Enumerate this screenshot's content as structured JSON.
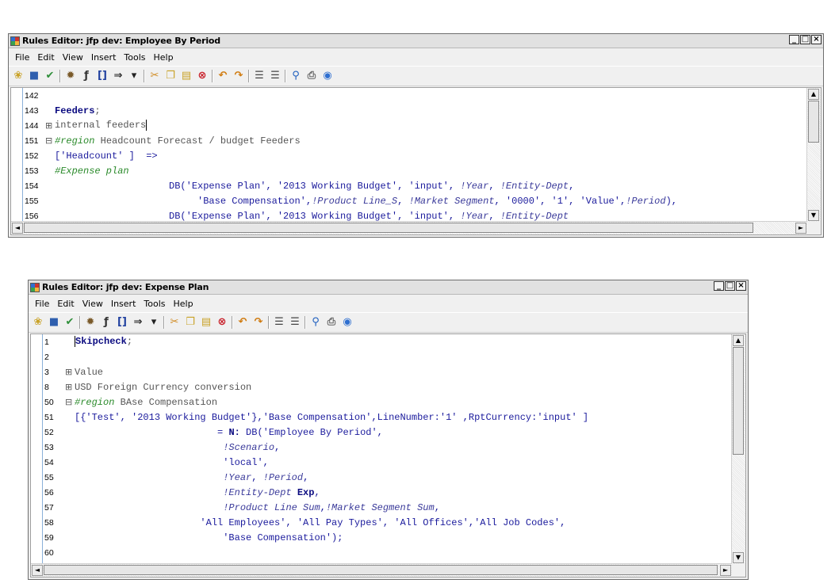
{
  "window1": {
    "title": "Rules Editor: jfp dev: Employee By Period",
    "menu": [
      "File",
      "Edit",
      "View",
      "Insert",
      "Tools",
      "Help"
    ],
    "lines": [
      {
        "num": "142",
        "fold": "",
        "segs": [
          {
            "t": "",
            "c": ""
          }
        ]
      },
      {
        "num": "143",
        "fold": "",
        "segs": [
          {
            "t": "Feeders",
            "c": "kw"
          },
          {
            "t": ";",
            "c": "gy"
          }
        ]
      },
      {
        "num": "144",
        "fold": "⊞",
        "segs": [
          {
            "t": "internal feeders",
            "c": "gy"
          }
        ],
        "caret": true
      },
      {
        "num": "151",
        "fold": "⊟",
        "segs": [
          {
            "t": "#region",
            "c": "cm"
          },
          {
            "t": " Headcount Forecast / budget Feeders",
            "c": "gy"
          }
        ]
      },
      {
        "num": "152",
        "fold": "",
        "segs": [
          {
            "t": "['Headcount' ]  =>",
            "c": ""
          }
        ]
      },
      {
        "num": "153",
        "fold": "",
        "segs": [
          {
            "t": "#Expense plan",
            "c": "cm"
          }
        ]
      },
      {
        "num": "154",
        "fold": "",
        "segs": [
          {
            "t": "                    DB('Expense Plan', '2013 Working Budget', 'input', ",
            "c": ""
          },
          {
            "t": "!Year",
            "c": "vr"
          },
          {
            "t": ", ",
            "c": ""
          },
          {
            "t": "!Entity-Dept",
            "c": "vr"
          },
          {
            "t": ",",
            "c": ""
          }
        ]
      },
      {
        "num": "155",
        "fold": "",
        "segs": [
          {
            "t": "                         'Base Compensation',",
            "c": ""
          },
          {
            "t": "!Product Line_S",
            "c": "vr"
          },
          {
            "t": ", ",
            "c": ""
          },
          {
            "t": "!Market Segment",
            "c": "vr"
          },
          {
            "t": ", '0000', '1', 'Value',",
            "c": ""
          },
          {
            "t": "!Period",
            "c": "vr"
          },
          {
            "t": "),",
            "c": ""
          }
        ]
      },
      {
        "num": "156",
        "fold": "",
        "segs": [
          {
            "t": "                    DB('Expense Plan', '2013 Working Budget', 'input', ",
            "c": ""
          },
          {
            "t": "!Year",
            "c": "vr"
          },
          {
            "t": ", ",
            "c": ""
          },
          {
            "t": "!Entity-Dept",
            "c": "vr"
          }
        ]
      }
    ]
  },
  "window2": {
    "title": "Rules Editor: jfp dev: Expense Plan",
    "menu": [
      "File",
      "Edit",
      "View",
      "Insert",
      "Tools",
      "Help"
    ],
    "lines": [
      {
        "num": "1",
        "fold": "",
        "segs": [
          {
            "t": "Skipcheck",
            "c": "kw"
          },
          {
            "t": ";",
            "c": "gy"
          }
        ],
        "caretStart": true
      },
      {
        "num": "2",
        "fold": "",
        "segs": [
          {
            "t": "",
            "c": ""
          }
        ]
      },
      {
        "num": "3",
        "fold": "⊞",
        "segs": [
          {
            "t": "Value",
            "c": "gy"
          }
        ]
      },
      {
        "num": "8",
        "fold": "⊞",
        "segs": [
          {
            "t": "USD Foreign Currency conversion",
            "c": "gy"
          }
        ]
      },
      {
        "num": "50",
        "fold": "⊟",
        "segs": [
          {
            "t": "#region",
            "c": "cm"
          },
          {
            "t": " BAse Compensation",
            "c": "gy"
          }
        ]
      },
      {
        "num": "51",
        "fold": "",
        "segs": [
          {
            "t": "[{'Test', '2013 Working Budget'},'Base Compensation',LineNumber:",
            "c": ""
          },
          {
            "t": "'1'",
            "c": ""
          },
          {
            "t": " ,RptCurrency:",
            "c": ""
          },
          {
            "t": "'input'",
            "c": ""
          },
          {
            "t": " ]",
            "c": ""
          }
        ]
      },
      {
        "num": "52",
        "fold": "",
        "segs": [
          {
            "t": "                         = ",
            "c": ""
          },
          {
            "t": "N:",
            "c": "kw"
          },
          {
            "t": " DB('Employee By Period',",
            "c": ""
          }
        ]
      },
      {
        "num": "53",
        "fold": "",
        "segs": [
          {
            "t": "                          ",
            "c": ""
          },
          {
            "t": "!Scenario",
            "c": "vr"
          },
          {
            "t": ",",
            "c": ""
          }
        ]
      },
      {
        "num": "54",
        "fold": "",
        "segs": [
          {
            "t": "                          'local',",
            "c": ""
          }
        ]
      },
      {
        "num": "55",
        "fold": "",
        "segs": [
          {
            "t": "                          ",
            "c": ""
          },
          {
            "t": "!Year",
            "c": "vr"
          },
          {
            "t": ", ",
            "c": ""
          },
          {
            "t": "!Period",
            "c": "vr"
          },
          {
            "t": ",",
            "c": ""
          }
        ]
      },
      {
        "num": "56",
        "fold": "",
        "segs": [
          {
            "t": "                          ",
            "c": ""
          },
          {
            "t": "!Entity-Dept",
            "c": "vr"
          },
          {
            "t": " ",
            "c": ""
          },
          {
            "t": "Exp",
            "c": "kw"
          },
          {
            "t": ",",
            "c": ""
          }
        ]
      },
      {
        "num": "57",
        "fold": "",
        "segs": [
          {
            "t": "                          ",
            "c": ""
          },
          {
            "t": "!Product Line Sum",
            "c": "vr"
          },
          {
            "t": ",",
            "c": ""
          },
          {
            "t": "!Market Segment Sum",
            "c": "vr"
          },
          {
            "t": ",",
            "c": ""
          }
        ]
      },
      {
        "num": "58",
        "fold": "",
        "segs": [
          {
            "t": "                      'All Employees', 'All Pay Types', 'All Offices','All Job Codes',",
            "c": ""
          }
        ]
      },
      {
        "num": "59",
        "fold": "",
        "segs": [
          {
            "t": "                          'Base Compensation');",
            "c": ""
          }
        ]
      },
      {
        "num": "60",
        "fold": "",
        "segs": [
          {
            "t": "",
            "c": ""
          }
        ]
      }
    ]
  },
  "toolbar_icons": [
    "open-icon",
    "save-icon",
    "check-syntax-icon",
    "gear-icon",
    "function-icon",
    "brackets-icon",
    "arrow-icon",
    "dropdown-icon",
    "cut-icon",
    "copy-icon",
    "paste-icon",
    "delete-icon",
    "undo-icon",
    "redo-icon",
    "indent-icon",
    "outdent-icon",
    "find-icon",
    "print-icon",
    "help-icon"
  ],
  "window_controls": {
    "minimize": "_",
    "maximize": "□",
    "close": "×"
  },
  "scroll_arrows": {
    "up": "▲",
    "down": "▼",
    "left": "◄",
    "right": "►"
  }
}
